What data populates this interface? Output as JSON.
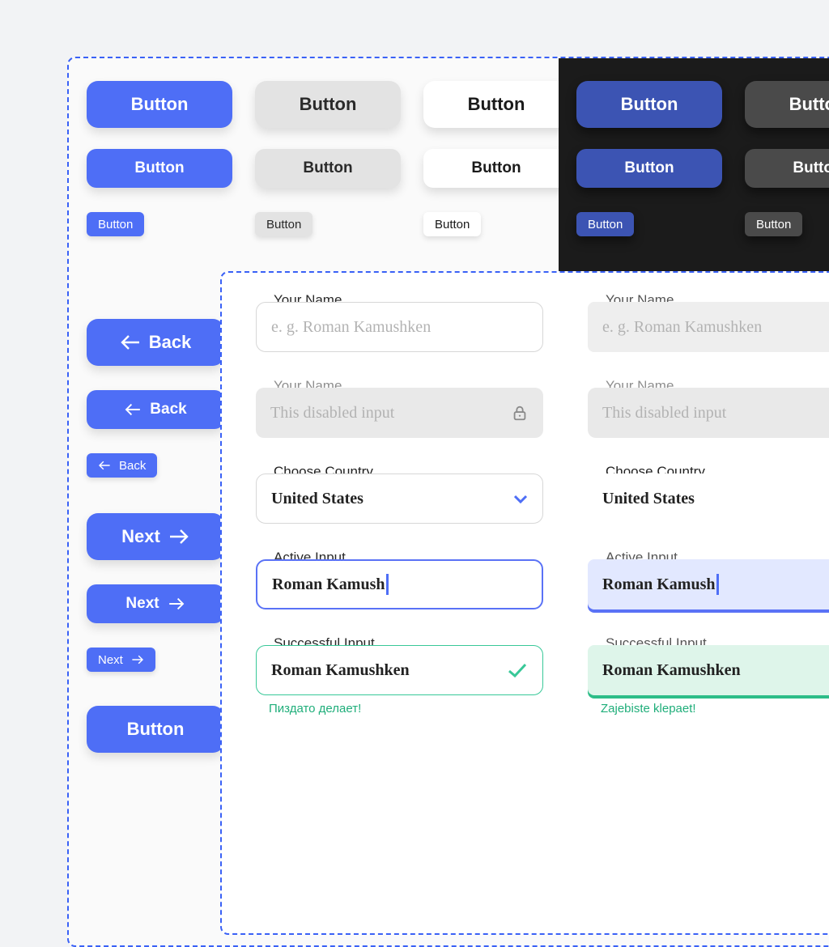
{
  "buttons": {
    "generic_label": "Button",
    "back_label": "Back",
    "next_label": "Next"
  },
  "forms": {
    "name_label": "Your Name",
    "name_placeholder": "e. g. Roman Kamushken",
    "disabled_placeholder": "This disabled input",
    "country_label": "Choose Country",
    "country_value": "United States",
    "active_label": "Active Input",
    "active_value": "Roman Kamush",
    "success_label": "Successful Input",
    "success_value": "Roman Kamushken",
    "success_helper_a": "Пиздато делает!",
    "success_helper_b": "Zajebiste klepaet!"
  },
  "colors": {
    "primary": "#4e6ef6",
    "success": "#2dbd88",
    "dark_bg": "#1b1b1b"
  }
}
